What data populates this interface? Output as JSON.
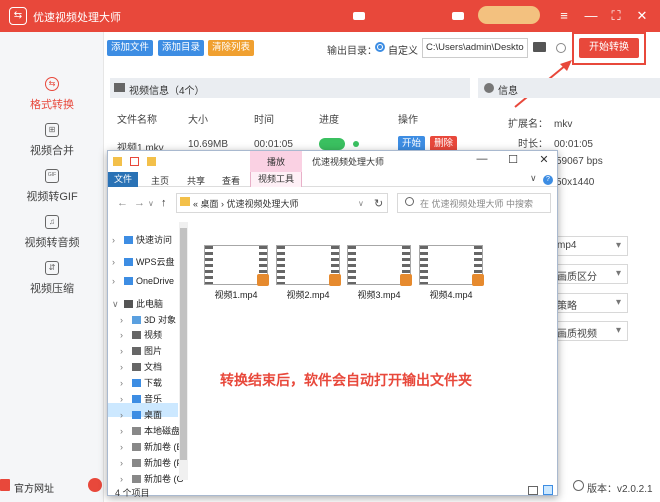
{
  "app": {
    "logo_glyph": "⇆",
    "title": "优速视频处理大师",
    "window_controls": {
      "menu": "≡",
      "minimize": "—",
      "maximize": "⛶",
      "close": "✕"
    }
  },
  "sidebar": {
    "items": [
      {
        "label": "格式转换",
        "icon": "format-convert-icon",
        "glyph": "⇆",
        "active": true
      },
      {
        "label": "视频合并",
        "icon": "merge-icon",
        "glyph": "⊞",
        "active": false
      },
      {
        "label": "视频转GIF",
        "icon": "gif-icon",
        "glyph": "GIF",
        "active": false
      },
      {
        "label": "视频转音频",
        "icon": "audio-icon",
        "glyph": "♫",
        "active": false
      },
      {
        "label": "视频压缩",
        "icon": "compress-icon",
        "glyph": "⇵",
        "active": false
      }
    ],
    "footer_site": "官方网址",
    "version": "版本：v2.0.2.1"
  },
  "toolbar": {
    "add_file": "添加文件",
    "add_folder": "添加目录",
    "clear_list": "清除列表",
    "output_label": "输出目录：",
    "radio_label": "自定义",
    "output_path": "C:\\Users\\admin\\Deskto",
    "start_button": "开始转换"
  },
  "video_panel": {
    "title": "视频信息（4个）",
    "columns": [
      "文件名称",
      "大小",
      "时间",
      "进度",
      "操作"
    ],
    "rows": [
      {
        "name": "视频1.mkv",
        "size": "10.69MB",
        "time": "00:01:05",
        "action_start": "开始",
        "action_delete": "删除"
      }
    ]
  },
  "info_panel": {
    "title": "信息",
    "rows": [
      {
        "label": "扩展名：",
        "value": "mkv"
      },
      {
        "label": "时长：",
        "value": "00:01:05"
      },
      {
        "label": "",
        "value": "59067 bps"
      },
      {
        "label": "",
        "value": "50x1440"
      }
    ],
    "selects": [
      "mp4",
      "画质区分",
      "策略",
      "画质视频"
    ]
  },
  "explorer": {
    "manage_tab": "播放",
    "title": "优速视频处理大师",
    "ribbon_tabs": [
      "文件",
      "主页",
      "共享",
      "查看",
      "视频工具"
    ],
    "nav": {
      "back": "←",
      "forward": "→",
      "up": "↑",
      "dropdown": "∨",
      "refresh": "↻",
      "help": "?",
      "expand": "∨"
    },
    "window_controls": {
      "minimize": "—",
      "maximize": "☐",
      "close": "✕"
    },
    "address_parts": "«  桌面  ›  优速视频处理大师",
    "search_placeholder": "在 优速视频处理大师 中搜索",
    "tree": [
      {
        "label": "快速访问",
        "arrow": "›",
        "color": "#3d8de3"
      },
      {
        "label": "WPS云盘",
        "arrow": "›",
        "color": "#3d8de3"
      },
      {
        "label": "OneDrive",
        "arrow": "›",
        "color": "#3d8de3"
      },
      {
        "label": "此电脑",
        "arrow": "∨",
        "color": "#555"
      },
      {
        "label": "3D 对象",
        "arrow": "›",
        "color": "#5aa0e0"
      },
      {
        "label": "视频",
        "arrow": "›",
        "color": "#666"
      },
      {
        "label": "图片",
        "arrow": "›",
        "color": "#666"
      },
      {
        "label": "文档",
        "arrow": "›",
        "color": "#666"
      },
      {
        "label": "下载",
        "arrow": "›",
        "color": "#3d8de3"
      },
      {
        "label": "音乐",
        "arrow": "›",
        "color": "#3d8de3"
      },
      {
        "label": "桌面",
        "arrow": "›",
        "color": "#3d8de3"
      },
      {
        "label": "本地磁盘",
        "arrow": "›",
        "color": "#888"
      },
      {
        "label": "新加卷 (E",
        "arrow": "›",
        "color": "#888"
      },
      {
        "label": "新加卷 (F:",
        "arrow": "›",
        "color": "#888"
      },
      {
        "label": "新加卷 (G",
        "arrow": "›",
        "color": "#888"
      }
    ],
    "files": [
      "视频1.mp4",
      "视频2.mp4",
      "视频3.mp4",
      "视频4.mp4"
    ],
    "status": "4 个项目"
  },
  "annotation": "转换结束后，软件会自动打开输出文件夹",
  "colors": {
    "brand": "#e8483b",
    "primary": "#3d8de3",
    "warning": "#f0a030",
    "success": "#3ac060"
  }
}
